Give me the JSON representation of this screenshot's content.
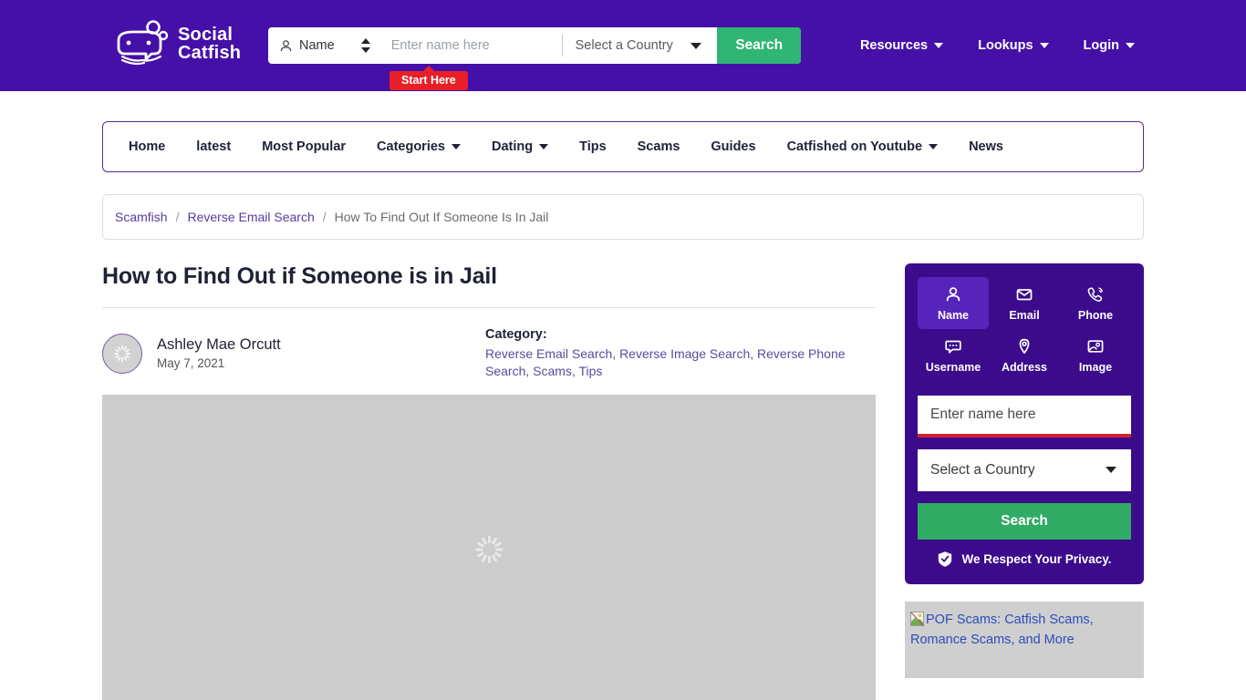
{
  "header": {
    "logo_text_line1": "Social",
    "logo_text_line2": "Catfish",
    "search": {
      "type_label": "Name",
      "name_placeholder": "Enter name here",
      "name_value": "",
      "country_label": "Select a Country",
      "search_button": "Search"
    },
    "start_here_badge": "Start Here",
    "links": [
      {
        "label": "Resources",
        "has_caret": true
      },
      {
        "label": "Lookups",
        "has_caret": true
      },
      {
        "label": "Login",
        "has_caret": true
      }
    ]
  },
  "nav": {
    "items": [
      {
        "label": "Home",
        "has_caret": false
      },
      {
        "label": "latest",
        "has_caret": false
      },
      {
        "label": "Most Popular",
        "has_caret": false
      },
      {
        "label": "Categories",
        "has_caret": true
      },
      {
        "label": "Dating",
        "has_caret": true
      },
      {
        "label": "Tips",
        "has_caret": false
      },
      {
        "label": "Scams",
        "has_caret": false
      },
      {
        "label": "Guides",
        "has_caret": false
      },
      {
        "label": "Catfished on Youtube",
        "has_caret": true
      },
      {
        "label": "News",
        "has_caret": false
      }
    ]
  },
  "breadcrumb": {
    "items": [
      {
        "label": "Scamfish",
        "current": false
      },
      {
        "label": "Reverse Email Search",
        "current": false
      },
      {
        "label": "How To Find Out If Someone Is In Jail",
        "current": true
      }
    ],
    "separator": "/"
  },
  "article": {
    "title": "How to Find Out if Someone is in Jail",
    "author": "Ashley Mae Orcutt",
    "date": "May 7, 2021",
    "category_label": "Category:",
    "categories": [
      "Reverse Email Search",
      "Reverse Image Search",
      "Reverse Phone Search",
      "Scams",
      "Tips"
    ]
  },
  "sidebar": {
    "tabs": [
      {
        "label": "Name",
        "icon": "person-icon",
        "active": true
      },
      {
        "label": "Email",
        "icon": "envelope-icon",
        "active": false
      },
      {
        "label": "Phone",
        "icon": "phone-icon",
        "active": false
      },
      {
        "label": "Username",
        "icon": "chat-bubble-icon",
        "active": false
      },
      {
        "label": "Address",
        "icon": "map-pin-icon",
        "active": false
      },
      {
        "label": "Image",
        "icon": "photo-icon",
        "active": false
      }
    ],
    "form": {
      "name_placeholder": "Enter name here",
      "name_value": "",
      "country_label": "Select a Country",
      "search_button": "Search",
      "privacy_text": "We Respect Your Privacy.",
      "privacy_icon": "shield-check-icon"
    },
    "promo": {
      "alt_text": "POF Scams: Catfish Scams, Romance Scams, and More",
      "icon": "broken-image-icon"
    }
  },
  "colors": {
    "header_purple": "#4510a8",
    "widget_purple": "#3b0b8c",
    "tab_active": "#5724bb",
    "green": "#2fb574",
    "sidebar_green": "#2fab63",
    "red_badge": "#e81f27",
    "input_underline_red": "#d0232f",
    "link_purple": "#5b3a9e",
    "placeholder_gray": "#ccc"
  }
}
